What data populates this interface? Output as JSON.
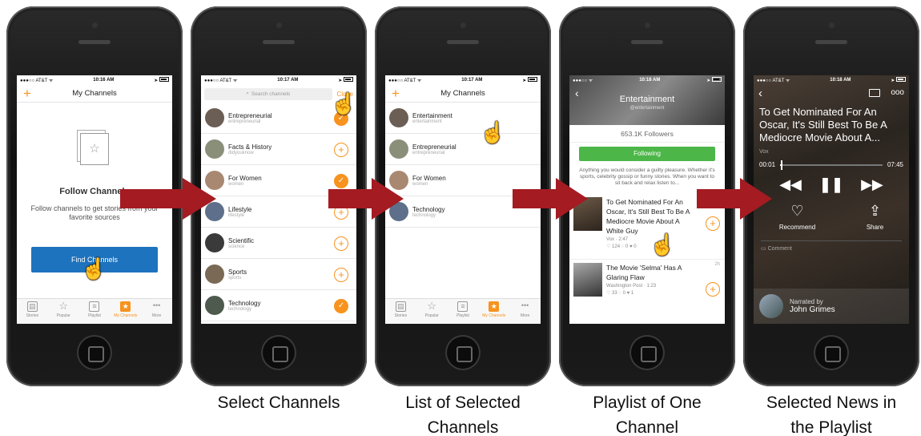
{
  "captions": {
    "select": "Select Channels",
    "list": "List of Selected Channels",
    "playlist": "Playlist of One Channel",
    "news": "Selected News in the Playlist"
  },
  "screen1": {
    "carrier": "●●●○○ AT&T ᯤ",
    "time": "10:16 AM",
    "title": "My Channels",
    "empty_title": "Follow Channels",
    "empty_desc": "Follow channels to get stories from your favorite sources",
    "find_button": "Find Channels"
  },
  "tabs": [
    "Stories",
    "Popular",
    "Playlist",
    "My Channels",
    "More"
  ],
  "screen2": {
    "carrier": "●●●○○ AT&T ᯤ",
    "time": "10:17 AM",
    "search_placeholder": "Search channels",
    "close": "Close",
    "channels": [
      {
        "name": "Entrepreneurial",
        "handle": "entrepreneurial",
        "followed": true
      },
      {
        "name": "Facts & History",
        "handle": "didyouknow",
        "followed": false
      },
      {
        "name": "For Women",
        "handle": "women",
        "followed": true
      },
      {
        "name": "Lifestyle",
        "handle": "lifestyle",
        "followed": false
      },
      {
        "name": "Scientific",
        "handle": "science",
        "followed": false
      },
      {
        "name": "Sports",
        "handle": "sports",
        "followed": false
      },
      {
        "name": "Technology",
        "handle": "technology",
        "followed": true
      }
    ]
  },
  "screen3": {
    "carrier": "●●●○○ AT&T ᯤ",
    "time": "10:17 AM",
    "title": "My Channels",
    "channels": [
      {
        "name": "Entertainment",
        "handle": "entertainment"
      },
      {
        "name": "Entrepreneurial",
        "handle": "entrepreneurial"
      },
      {
        "name": "For Women",
        "handle": "women"
      },
      {
        "name": "Technology",
        "handle": "technology"
      }
    ]
  },
  "screen4": {
    "carrier": "●●●○○ ᯤ",
    "time": "10:18 AM",
    "channel": "Entertainment",
    "handle": "@entertainment",
    "followers": "653.1K Followers",
    "following": "Following",
    "description": "Anything you would consider a guilty pleasure. Whether it's sports, celebrity gossip or funny stories. When you want to sit back and relax listen to...",
    "stories": [
      {
        "title": "To Get Nominated For An Oscar, It's Still Best To Be A Mediocre Movie About A White Guy",
        "source": "Vox · 2:47",
        "stats": "♡ 124  ◌ 0  ♥ 0"
      },
      {
        "title": "The Movie 'Selma' Has A Glaring Flaw",
        "source": "Washington Post · 1:23",
        "stats": "♡ 33  ◌ 0  ♥ 1",
        "age": "2h"
      }
    ]
  },
  "screen5": {
    "carrier": "●●●○○ AT&T ᯤ",
    "time": "10:18 AM",
    "title": "To Get Nominated For An Oscar, It's Still Best To Be A Mediocre Movie About A...",
    "source": "Vox",
    "elapsed": "00:01",
    "duration": "07:45",
    "progress": 0.01,
    "recommend": "Recommend",
    "share": "Share",
    "comment": "Comment",
    "narrated_by": "Narrated by",
    "narrator": "John Grimes"
  },
  "colors": {
    "accent": "#f7931e",
    "blue": "#1e73be",
    "green": "#4cb648",
    "arrow": "#a41b22"
  }
}
